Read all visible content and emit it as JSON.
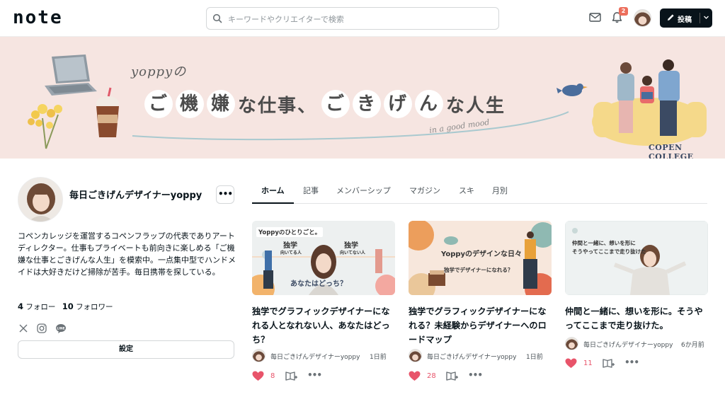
{
  "header": {
    "logo": "note",
    "search_placeholder": "キーワードやクリエイターで検索",
    "notification_count": "2",
    "post_label": "投稿"
  },
  "banner": {
    "prefix": "yoppyの",
    "title_parts": [
      {
        "text": "ご",
        "circled": true
      },
      {
        "text": "機",
        "circled": true
      },
      {
        "text": "嫌",
        "circled": true
      },
      {
        "text": "な仕事、",
        "circled": false
      },
      {
        "text": "ご",
        "circled": true
      },
      {
        "text": "き",
        "circled": true
      },
      {
        "text": "げ",
        "circled": true
      },
      {
        "text": "ん",
        "circled": true
      },
      {
        "text": "な人生",
        "circled": false
      }
    ],
    "tagline": "in a good mood",
    "brand": "COPEN COLLEGE"
  },
  "profile": {
    "name": "毎日ごきげんデザイナーyoppy",
    "more_label": "•••",
    "bio": "コペンカレッジを運営するコペンフラップの代表でありアートディレクター。仕事もプライベートも前向きに楽しめる「ご機嫌な仕事とごきげんな人生」を模索中。一点集中型でハンドメイドは大好きだけど掃除が苦手。毎日携帯を探している。",
    "follow_count": "4",
    "follow_label": "フォロー",
    "follower_count": "10",
    "follower_label": "フォロワー",
    "settings_label": "設定"
  },
  "tabs": [
    "ホーム",
    "記事",
    "メンバーシップ",
    "マガジン",
    "スキ",
    "月別"
  ],
  "cards": [
    {
      "title": "独学でグラフィックデザイナーになれる人となれない人、あなたはどっち？",
      "author": "毎日ごきげんデザイナーyoppy",
      "ago": "1日前",
      "likes": "8",
      "thumb": {
        "head": "Yoppyのひとりごと。",
        "left": "独学",
        "left_sub": "向いてる人",
        "right": "独学",
        "right_sub": "向いてない人",
        "bottom": "あなたはどっち？"
      }
    },
    {
      "title": "独学でグラフィックデザイナーになれる？未経験からデザイナーへのロードマップ",
      "author": "毎日ごきげんデザイナーyoppy",
      "ago": "1日前",
      "likes": "28",
      "thumb": {
        "head": "Yoppyのデザインな日々",
        "sub": "独学でデザイナーになれる？"
      }
    },
    {
      "title": "仲間と一緒に、想いを形に。そうやってここまで走り抜けた。",
      "author": "毎日ごきげんデザイナーyoppy",
      "ago": "6か月前",
      "likes": "11",
      "thumb": {
        "head": "仲間と一緒に、想いを形に",
        "sub": "そうやってここまで走り抜けた"
      }
    }
  ],
  "colors": {
    "brand_dark": "#08131a",
    "like_red": "#e8546a",
    "banner_bg": "#f6e5e1",
    "badge": "#ec6e5c"
  }
}
